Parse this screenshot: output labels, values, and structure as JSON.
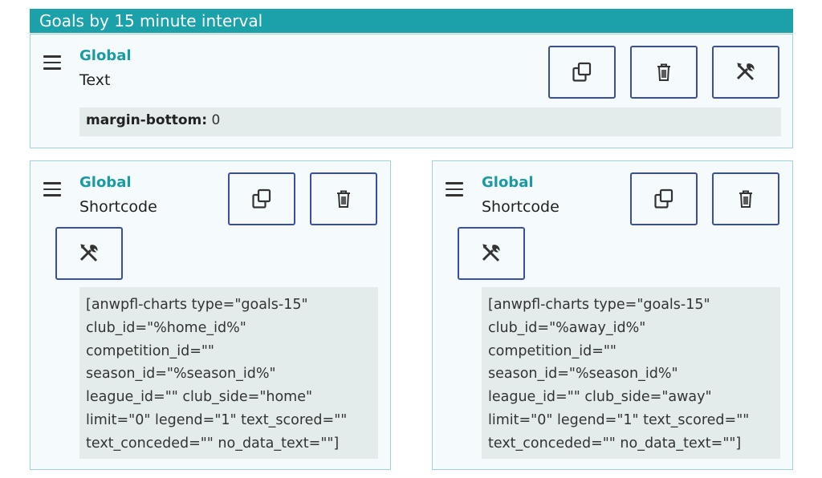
{
  "header": {
    "title": "Goals by 15 minute interval"
  },
  "text_block": {
    "kind": "Global",
    "type": "Text",
    "attr_key": "margin-bottom:",
    "attr_value": "0",
    "buttons": {
      "copy": "copy-icon",
      "delete": "trash-icon",
      "settings": "tools-icon"
    }
  },
  "shortcode_left": {
    "kind": "Global",
    "type": "Shortcode",
    "code": "[anwpfl-charts type=\"goals-15\"\nclub_id=\"%home_id%\"\ncompetition_id=\"\"\nseason_id=\"%season_id%\"\nleague_id=\"\" club_side=\"home\"\nlimit=\"0\" legend=\"1\" text_scored=\"\"\ntext_conceded=\"\" no_data_text=\"\"]"
  },
  "shortcode_right": {
    "kind": "Global",
    "type": "Shortcode",
    "code": "[anwpfl-charts type=\"goals-15\"\nclub_id=\"%away_id%\"\ncompetition_id=\"\"\nseason_id=\"%season_id%\"\nleague_id=\"\" club_side=\"away\"\nlimit=\"0\" legend=\"1\" text_scored=\"\"\ntext_conceded=\"\" no_data_text=\"\"]"
  },
  "colors": {
    "header": "#1aa1a9",
    "accent": "#1a9aa2",
    "button_border": "#3a4fa3",
    "block_border": "#9fd3da"
  }
}
